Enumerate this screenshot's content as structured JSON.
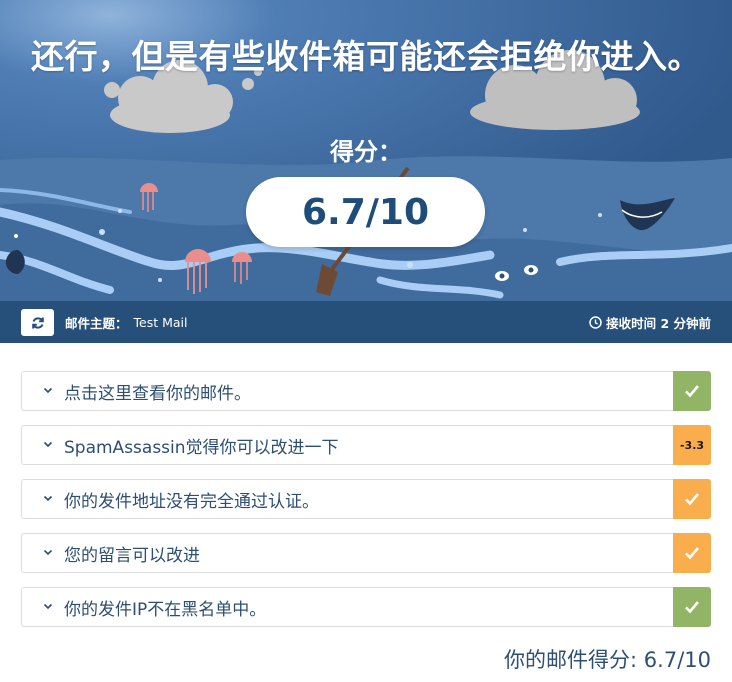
{
  "hero": {
    "headline": "还行，但是有些收件箱可能还会拒绝你进入。",
    "score_label": "得分：",
    "score": "6.7/10"
  },
  "info_bar": {
    "refresh_icon": "refresh-icon",
    "subject_label": "邮件主题：",
    "subject_value": "Test Mail",
    "received_icon": "clock-icon",
    "received_text": "接收时间 2 分钟前"
  },
  "checks": [
    {
      "label": "点击这里查看你的邮件。",
      "status": "pass",
      "badge": "",
      "color": "#92b565"
    },
    {
      "label": "SpamAssassin觉得你可以改进一下",
      "status": "warning",
      "badge": "-3.3",
      "color": "#f9ad4c"
    },
    {
      "label": "你的发件地址没有完全通过认证。",
      "status": "warning",
      "badge": "",
      "color": "#f9ad4c"
    },
    {
      "label": "您的留言可以改进",
      "status": "warning",
      "badge": "",
      "color": "#f9ad4c"
    },
    {
      "label": "你的发件IP不在黑名单中。",
      "status": "pass",
      "badge": "",
      "color": "#92b565"
    }
  ],
  "total": "你的邮件得分: 6.7/10",
  "colors": {
    "sky": "#3b6ba2",
    "sea": "#4a77a8",
    "info_bar": "#264f7a",
    "pass": "#92b565",
    "warning": "#f9ad4c",
    "text": "#2d4f72"
  }
}
